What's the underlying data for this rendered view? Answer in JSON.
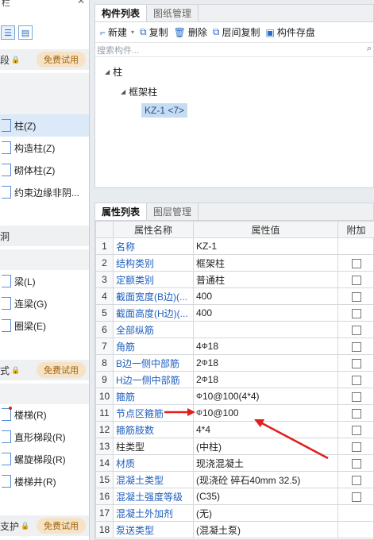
{
  "left": {
    "title": "栏",
    "categories": [
      {
        "label": "段",
        "badge": "免费试用"
      },
      {
        "label": "洞",
        "badge": ""
      },
      {
        "label": "式",
        "badge": "免费试用"
      },
      {
        "label": "支护",
        "badge": "免费试用"
      }
    ],
    "col_items": [
      "柱(Z)",
      "构造柱(Z)",
      "砌体柱(Z)",
      "约束边缘非阴..."
    ],
    "beam_items": [
      "梁(L)",
      "连梁(G)",
      "圈梁(E)"
    ],
    "stair_items": [
      "楼梯(R)",
      "直形梯段(R)",
      "螺旋梯段(R)",
      "楼梯井(R)"
    ]
  },
  "component_panel": {
    "tabs": [
      "构件列表",
      "图纸管理"
    ],
    "toolbar": {
      "new": "新建",
      "copy": "复制",
      "delete": "删除",
      "floor_copy": "层间复制",
      "save": "构件存盘"
    },
    "search_placeholder": "搜索构件...",
    "tree": {
      "root": "柱",
      "child": "框架柱",
      "leaf": "KZ-1 <7>"
    }
  },
  "property_panel": {
    "tabs": [
      "属性列表",
      "图层管理"
    ],
    "headers": {
      "name": "属性名称",
      "value": "属性值",
      "extra": "附加"
    },
    "rows": [
      {
        "n": "1",
        "name": "名称",
        "value": "KZ-1",
        "link": true,
        "check": false
      },
      {
        "n": "2",
        "name": "结构类别",
        "value": "框架柱",
        "link": true,
        "check": true
      },
      {
        "n": "3",
        "name": "定额类别",
        "value": "普通柱",
        "link": true,
        "check": true
      },
      {
        "n": "4",
        "name": "截面宽度(B边)(...",
        "value": "400",
        "link": true,
        "check": true
      },
      {
        "n": "5",
        "name": "截面高度(H边)(...",
        "value": "400",
        "link": true,
        "check": true
      },
      {
        "n": "6",
        "name": "全部纵筋",
        "value": "",
        "link": true,
        "check": true
      },
      {
        "n": "7",
        "name": "角筋",
        "value": "4",
        "rebar": true,
        "value2": "18",
        "link": true,
        "check": true
      },
      {
        "n": "8",
        "name": "B边一侧中部筋",
        "value": "2",
        "rebar": true,
        "value2": "18",
        "link": true,
        "check": true
      },
      {
        "n": "9",
        "name": "H边一侧中部筋",
        "value": "2",
        "rebar": true,
        "value2": "18",
        "link": true,
        "check": true
      },
      {
        "n": "10",
        "name": "箍筋",
        "value": "",
        "rebar": true,
        "value2": "10@100(4*4)",
        "link": true,
        "check": true
      },
      {
        "n": "11",
        "name": "节点区箍筋",
        "value": "",
        "rebar": true,
        "value2": "10@100",
        "link": true,
        "check": true
      },
      {
        "n": "12",
        "name": "箍筋肢数",
        "value": "4*4",
        "link": true,
        "check": true
      },
      {
        "n": "13",
        "name": "柱类型",
        "value": "(中柱)",
        "link": false,
        "check": true
      },
      {
        "n": "14",
        "name": "材质",
        "value": "现浇混凝土",
        "link": true,
        "check": true
      },
      {
        "n": "15",
        "name": "混凝土类型",
        "value": "(现浇砼 碎石40mm 32.5)",
        "link": true,
        "check": true
      },
      {
        "n": "16",
        "name": "混凝土强度等级",
        "value": "(C35)",
        "link": true,
        "check": true
      },
      {
        "n": "17",
        "name": "混凝土外加剂",
        "value": "(无)",
        "link": true,
        "check": false
      },
      {
        "n": "18",
        "name": "泵送类型",
        "value": "(混凝土泵)",
        "link": true,
        "check": false
      }
    ]
  },
  "colors": {
    "accent": "#2b6cc4",
    "link": "#1f5fbf",
    "arrow": "#e01e1e",
    "badge_bg": "#f6e3c6"
  },
  "icons": {
    "rebar": "Φ-with-bar"
  }
}
